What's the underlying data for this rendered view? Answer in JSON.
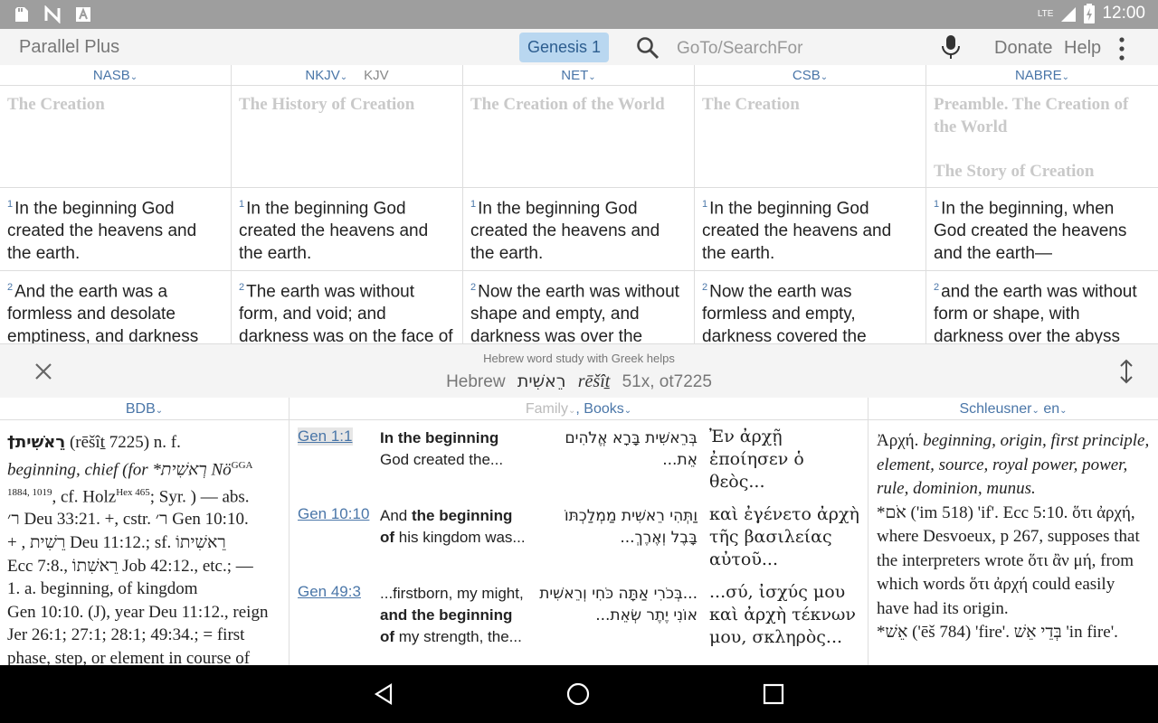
{
  "status_bar": {
    "network": "LTE",
    "time": "12:00"
  },
  "app": {
    "title": "Parallel Plus",
    "reference": "Genesis 1",
    "search_placeholder": "GoTo/SearchFor",
    "donate": "Donate",
    "help": "Help"
  },
  "columns": [
    {
      "version": "NASB",
      "heading": "The Creation",
      "heading2": "",
      "v1_num": "1",
      "v1": "In the beginning God created the heavens and the earth.",
      "v2_num": "2",
      "v2": "And the earth was a formless and desolate emptiness, and darkness"
    },
    {
      "version": "NKJV",
      "alt_version": "KJV",
      "heading": "The History of Creation",
      "heading2": "",
      "v1_num": "1",
      "v1": "In the beginning God created the heavens and the earth.",
      "v2_num": "2",
      "v2": "The earth was without form, and void; and darkness was on the face of the deep."
    },
    {
      "version": "NET",
      "heading": "The Creation of the World",
      "heading2": "",
      "v1_num": "1",
      "v1": "In the beginning God created the heavens and the earth.",
      "v2_num": "2",
      "v2": "Now the earth was without shape and empty, and darkness was over the"
    },
    {
      "version": "CSB",
      "heading": "The Creation",
      "heading2": "",
      "v1_num": "1",
      "v1": "In the beginning God created the heavens and the earth.",
      "v2_num": "2",
      "v2": "Now the earth was formless and empty, darkness covered the"
    },
    {
      "version": "NABRE",
      "heading": "Preamble. The Creation of the World",
      "heading2": "The Story of Creation",
      "v1_num": "1",
      "v1": "In the beginning, when God created the heavens and the earth—",
      "v2_num": "2",
      "v2": "and the earth was without form or shape, with darkness over the abyss and a mighty"
    }
  ],
  "word_study": {
    "caption": "Hebrew word study with Greek helps",
    "language": "Hebrew",
    "hebrew": "רֵאשִׁית",
    "translit": "rēšîṯ",
    "stats": "51x, ot7225"
  },
  "panes": {
    "left_title": "BDB",
    "mid_family": "Family",
    "mid_books": "Books",
    "right_title": "Schleusner",
    "right_lang": "en"
  },
  "bdb": {
    "line1_head": "†רֵאשִׁית",
    "line1_rest": "(rēšîṯ 7225)  n. f.",
    "line2": "beginning, chief (for *רְאשִׁית Nö",
    "line2_sup": "GGA",
    "line3_sup": "1884, 1019",
    "line3": ", cf. Holz",
    "line3_sup2": "Hex 465",
    "line3_end": "; Syr. ) — abs.",
    "line4": "ר׳ Deu 33:21. +, cstr. ר׳ Gen 10:10.",
    "line5": "+ , רֵשִׁית Deu 11:12.; sf. רֵאשִׁיתוֹ",
    "line6": "Ecc 7:8., רֵאשִׁתוֹ Job 42:12., etc.; —",
    "line7": "1. a. beginning, of kingdom",
    "line8": "Gen 10:10. (J), year Deu 11:12., reign",
    "line9": "Jer 26:1; 27:1; 28:1; 49:34.; = first",
    "line10": "phase, step, or element in course of"
  },
  "occurrences": [
    {
      "ref": "Gen 1:1",
      "eng_bold": "In the beginning",
      "eng_rest": " God created the...",
      "heb": "בְּרֵאשִׁית בָּרָא אֱלֹהִים אֵת...",
      "grk": "Ἐν ἀρχῇ ἐποίησεν ὁ θεὸς..."
    },
    {
      "ref": "Gen 10:10",
      "eng_pre": "And ",
      "eng_bold": "the beginning of",
      "eng_rest": " his kingdom was...",
      "heb": "וַתְּהִי רֵאשִׁית מַמְלַכְתּוֹ בָּבֶל וְאֶרֶךְ...",
      "grk": "καὶ ἐγένετο ἀρχὴ τῆς βασιλείας αὐτοῦ..."
    },
    {
      "ref": "Gen 49:3",
      "eng_pre": "...firstborn, my might, ",
      "eng_bold": "and the beginning of",
      "eng_rest": " my strength, the...",
      "heb": "...בְּכֹרִי אַתָּה כֹּחִי וְרֵאשִׁית אוֹנִי יֶתֶר שְׂאֵת...",
      "grk": "...σύ, ἰσχύς μου καὶ ἀρχὴ τέκνων μου, σκληρὸς..."
    }
  ],
  "schleusner": {
    "p1_head": "Ἀρχή.",
    "p1": " beginning, origin, first principle, element, source, royal power, power, rule, dominion, munus.",
    "p2_head": "*אֹם",
    "p2": " ('im 518)  'if'. Ecc 5:10. ὅτι ἀρχή, where Desvoeux, p 267, supposes that the interpreters wrote ὅτι ἂν μή, from which words ὅτι ἀρχή could easily have had its origin.",
    "p3_head": "*אֵשׁ",
    "p3": " ('ēš 784)  'fire'. בְּדֵי אֵשׁ 'in fire'."
  }
}
